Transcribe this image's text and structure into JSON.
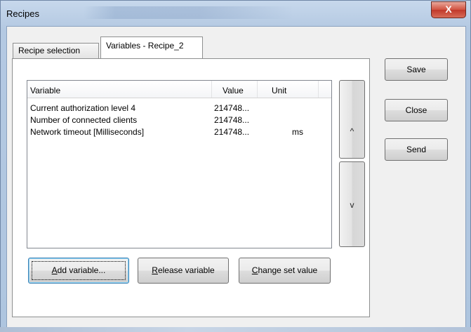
{
  "window": {
    "title": "Recipes",
    "close_label": "X"
  },
  "tabs": [
    {
      "label": "Recipe selection",
      "active": false
    },
    {
      "label": "Variables - Recipe_2",
      "active": true
    }
  ],
  "list": {
    "columns": [
      "Variable",
      "Value",
      "Unit"
    ],
    "rows": [
      {
        "variable": "Current authorization level 4",
        "value": "214748...",
        "unit": ""
      },
      {
        "variable": "Number of connected clients",
        "value": "214748...",
        "unit": ""
      },
      {
        "variable": "Network timeout [Milliseconds]",
        "value": "214748...",
        "unit": "ms"
      }
    ]
  },
  "scroll": {
    "up_label": "^",
    "down_label": "v"
  },
  "buttons": {
    "add_variable": {
      "mnemonic": "A",
      "rest": "dd variable..."
    },
    "release_variable": {
      "mnemonic": "R",
      "rest": "elease variable"
    },
    "change_set_value": {
      "mnemonic": "C",
      "rest": "hange set value"
    },
    "save": "Save",
    "close": "Close",
    "send": "Send"
  }
}
